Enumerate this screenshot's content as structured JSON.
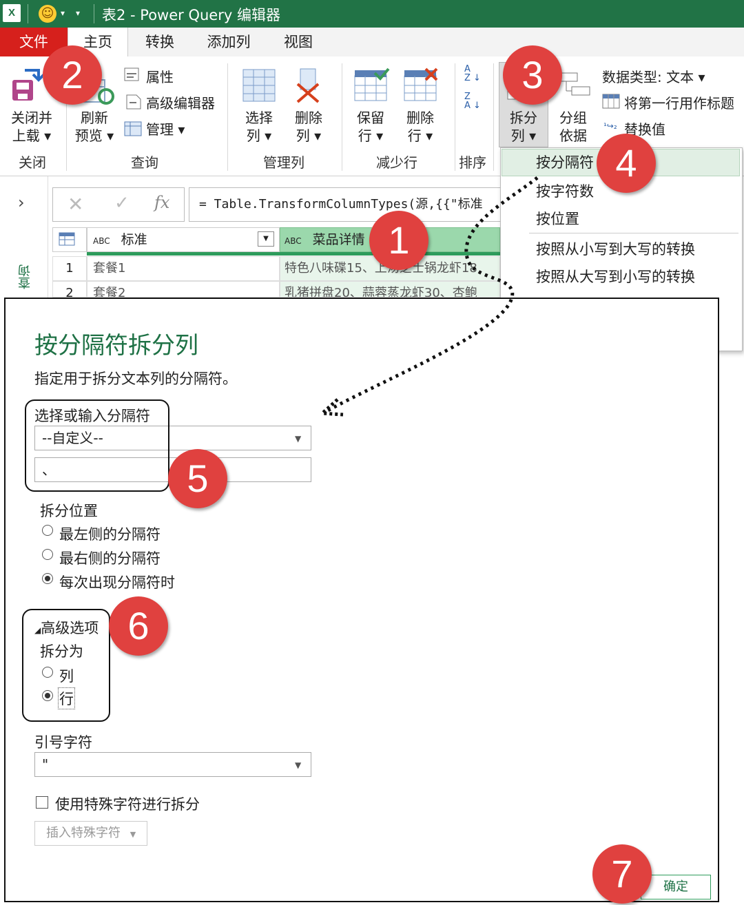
{
  "window": {
    "title": "表2 - Power Query 编辑器",
    "excel_icon": "X"
  },
  "menu_tabs": [
    "文件",
    "主页",
    "转换",
    "添加列",
    "视图"
  ],
  "ribbon": {
    "close_load": [
      "关闭并",
      "上载"
    ],
    "refresh": [
      "刷新",
      "预览"
    ],
    "properties": "属性",
    "advanced_editor": "高级编辑器",
    "manage": "管理",
    "choose_columns": [
      "选择",
      "列"
    ],
    "remove_columns": [
      "删除",
      "列"
    ],
    "keep_rows": [
      "保留",
      "行"
    ],
    "remove_rows": [
      "删除",
      "行"
    ],
    "split_column": [
      "拆分",
      "列"
    ],
    "group_by": [
      "分组",
      "依据"
    ],
    "data_type": "数据类型: 文本",
    "first_row_header": "将第一行用作标题",
    "replace_values": "替换值",
    "groups": [
      "关闭",
      "查询",
      "管理列",
      "减少行",
      "排序"
    ]
  },
  "formula": {
    "text": "= Table.TransformColumnTypes(源,{{\"标准",
    "fx": "fx"
  },
  "left_pane": {
    "label": "查询"
  },
  "grid": {
    "columns": [
      "标准",
      "菜品详情"
    ],
    "type_glyph": "ABC",
    "rows": [
      {
        "num": "1",
        "c1": "套餐1",
        "c2": "特色八味碟15、上汤芝士锅龙虾18"
      },
      {
        "num": "2",
        "c1": "套餐2",
        "c2": "乳猪拼盘20、蒜蓉蒸龙虾30、杏鲍"
      }
    ]
  },
  "split_menu": [
    "按分隔符",
    "按字符数",
    "按位置",
    "按照从小写到大写的转换",
    "按照从大写到小写的转换"
  ],
  "dialog": {
    "title": "按分隔符拆分列",
    "description": "指定用于拆分文本列的分隔符。",
    "delimiter_label": "选择或输入分隔符",
    "delimiter_value": "--自定义--",
    "custom_value": "、",
    "split_at_label": "拆分位置",
    "split_at_options": [
      {
        "label": "最左侧的分隔符",
        "selected": false
      },
      {
        "label": "最右侧的分隔符",
        "selected": false
      },
      {
        "label": "每次出现分隔符时",
        "selected": true
      }
    ],
    "advanced_label": "高级选项",
    "split_into_label": "拆分为",
    "split_into_options": [
      {
        "label": "列",
        "selected": false
      },
      {
        "label": "行",
        "selected": true
      }
    ],
    "quote_label": "引号字符",
    "quote_value": "\"",
    "special_chars_label": "使用特殊字符进行拆分",
    "insert_special_label": "插入特殊字符",
    "ok_label": "确定"
  },
  "badges": [
    "1",
    "2",
    "3",
    "4",
    "5",
    "6",
    "7"
  ],
  "colors": {
    "excel_green": "#217346",
    "file_red": "#d6201c",
    "badge_red": "#e0413f",
    "title_green": "#1e7145"
  }
}
